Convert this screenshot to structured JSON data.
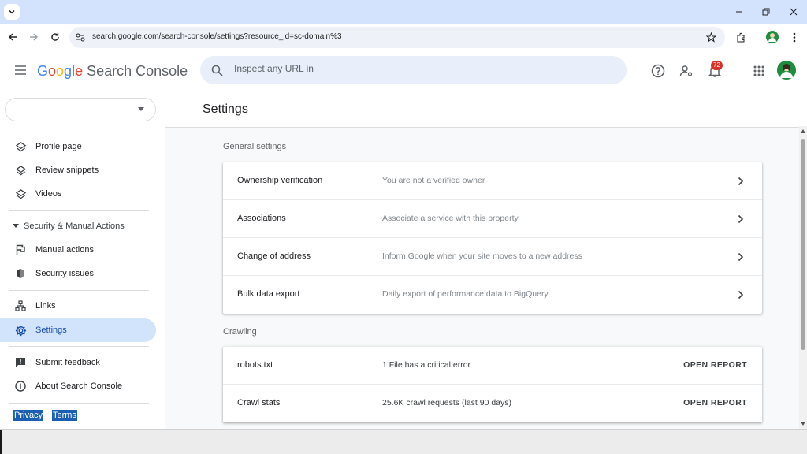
{
  "browser": {
    "url": "search.google.com/search-console/settings?resource_id=sc-domain%3"
  },
  "header": {
    "logo_google": [
      "G",
      "o",
      "o",
      "g",
      "l",
      "e"
    ],
    "logo_product": "Search Console",
    "search_placeholder": "Inspect any URL in",
    "notification_count": "72"
  },
  "sidebar": {
    "items": [
      {
        "label": "Profile page",
        "icon": "layers-icon"
      },
      {
        "label": "Review snippets",
        "icon": "layers-icon"
      },
      {
        "label": "Videos",
        "icon": "layers-icon"
      }
    ],
    "security_section": "Security & Manual Actions",
    "security_items": [
      {
        "label": "Manual actions",
        "icon": "flag-icon"
      },
      {
        "label": "Security issues",
        "icon": "shield-icon"
      }
    ],
    "links_label": "Links",
    "settings_label": "Settings",
    "feedback_label": "Submit feedback",
    "about_label": "About Search Console",
    "privacy_label": "Privacy",
    "terms_label": "Terms"
  },
  "main": {
    "page_title": "Settings",
    "general_label": "General settings",
    "general_rows": [
      {
        "title": "Ownership verification",
        "desc": "You are not a verified owner"
      },
      {
        "title": "Associations",
        "desc": "Associate a service with this property"
      },
      {
        "title": "Change of address",
        "desc": "Inform Google when your site moves to a new address"
      },
      {
        "title": "Bulk data export",
        "desc": "Daily export of performance data to BigQuery"
      }
    ],
    "crawling_label": "Crawling",
    "crawling_rows": [
      {
        "title": "robots.txt",
        "desc": "1 File has a critical error",
        "action": "OPEN REPORT"
      },
      {
        "title": "Crawl stats",
        "desc": "25.6K crawl requests (last 90 days)",
        "action": "OPEN REPORT"
      }
    ]
  },
  "colors": {
    "accent": "#1a73e8",
    "active_nav": "#d2e3fc",
    "titlebar": "#d3e3fd",
    "badge": "#d93025"
  }
}
